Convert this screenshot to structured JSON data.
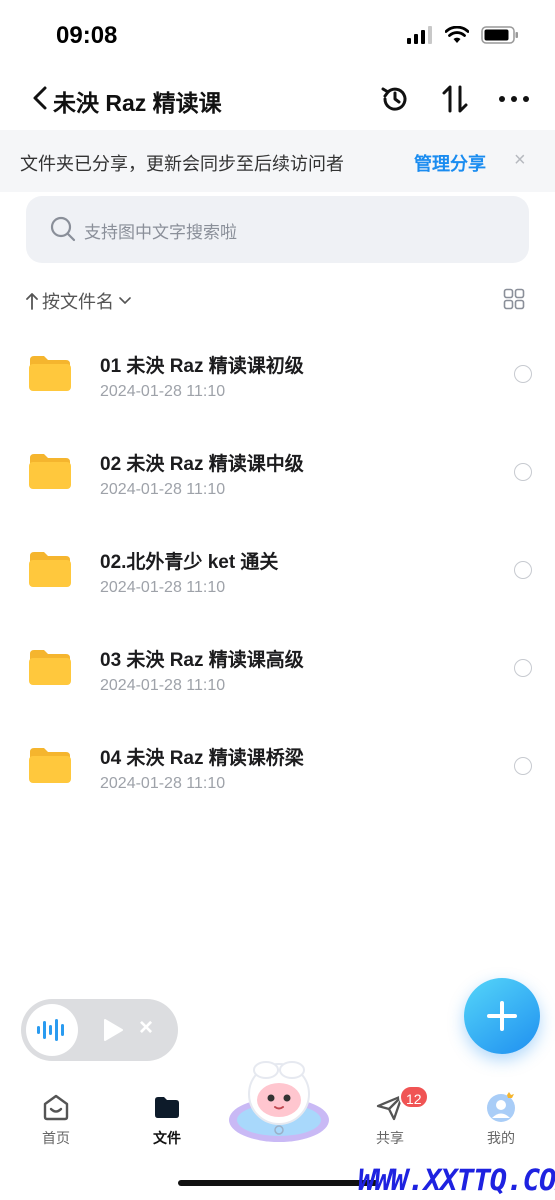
{
  "status_bar": {
    "time": "09:08"
  },
  "nav": {
    "title": "未泱 Raz 精读课",
    "icons": [
      "back-icon",
      "history-icon",
      "sort-transfer-icon",
      "more-icon"
    ]
  },
  "share_banner": {
    "text": "文件夹已分享，更新会同步至后续访问者",
    "action": "管理分享",
    "close": "×"
  },
  "search": {
    "placeholder": "支持图中文字搜索啦"
  },
  "sort": {
    "label": "按文件名"
  },
  "files": [
    {
      "name": "01 未泱 Raz 精读课初级",
      "date": "2024-01-28 11:10"
    },
    {
      "name": "02 未泱 Raz 精读课中级",
      "date": "2024-01-28 11:10"
    },
    {
      "name": "02.北外青少 ket 通关",
      "date": "2024-01-28 11:10"
    },
    {
      "name": "03 未泱 Raz 精读课高级",
      "date": "2024-01-28 11:10"
    },
    {
      "name": "04 未泱 Raz 精读课桥梁",
      "date": "2024-01-28 11:10"
    }
  ],
  "audio_player": {
    "close": "×"
  },
  "tabs": [
    {
      "label": "首页",
      "icon": "home-icon"
    },
    {
      "label": "文件",
      "icon": "folder-icon",
      "active": true
    },
    {
      "label": "共享",
      "icon": "send-icon",
      "badge": "12"
    },
    {
      "label": "我的",
      "icon": "avatar-icon"
    }
  ],
  "watermark": "WWW.XXTTQ.COM",
  "colors": {
    "accent": "#1a8cf0",
    "folder": "#ffc83d",
    "badge": "#f05454"
  }
}
